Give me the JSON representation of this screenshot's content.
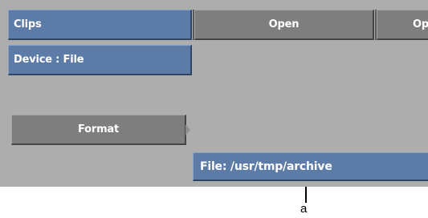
{
  "toolbar": {
    "clips_label": "Clips",
    "open_label": "Open",
    "open2_label_truncated": "Op"
  },
  "device": {
    "label": "Device : File"
  },
  "format": {
    "label": "Format"
  },
  "file_path": {
    "value": "File: /usr/tmp/archive"
  },
  "callout": {
    "label": "a"
  },
  "colors": {
    "panel_bg": "#adadad",
    "blue_button": "#5d7ba7",
    "gray_button": "#7e7e7e"
  }
}
